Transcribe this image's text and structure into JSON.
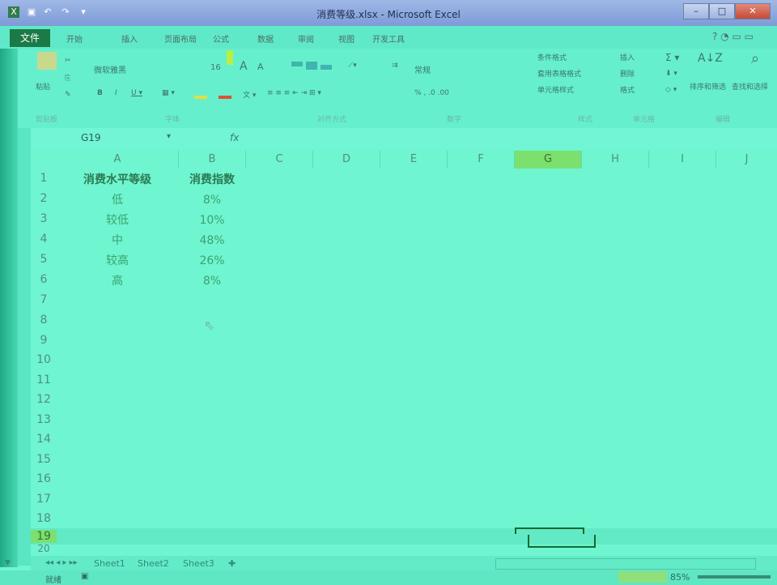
{
  "window": {
    "title": "消费等级.xlsx - Microsoft Excel",
    "quick_access": [
      "save-icon",
      "undo-icon",
      "redo-icon",
      "customize-icon"
    ],
    "buttons": [
      "minimize",
      "maximize",
      "close"
    ]
  },
  "ribbon": {
    "file_tab": "文件",
    "tabs": [
      "开始",
      "插入",
      "页面布局",
      "公式",
      "数据",
      "审阅",
      "视图",
      "开发工具"
    ],
    "font_name": "微软雅黑",
    "font_size": "16",
    "number_format": "常规",
    "paste_label": "粘贴",
    "styles": [
      "条件格式",
      "套用表格格式",
      "单元格样式"
    ],
    "cells": [
      "插入",
      "删除",
      "格式"
    ],
    "editing": [
      "排序和筛选",
      "查找和选择"
    ],
    "groups": [
      "剪贴板",
      "字体",
      "对齐方式",
      "数字",
      "样式",
      "单元格",
      "编辑"
    ]
  },
  "formula_bar": {
    "name_box": "G19",
    "fx": "fx",
    "value": ""
  },
  "sheet": {
    "columns": [
      "A",
      "B",
      "C",
      "D",
      "E",
      "F",
      "G",
      "H",
      "I",
      "J"
    ],
    "selected_column": "G",
    "rows": [
      "1",
      "2",
      "3",
      "4",
      "5",
      "6",
      "7",
      "8",
      "9",
      "10",
      "11",
      "12",
      "13",
      "14",
      "15",
      "16",
      "17",
      "18",
      "19",
      "20"
    ],
    "data": [
      [
        "消费水平等级",
        "消费指数"
      ],
      [
        "低",
        "8%"
      ],
      [
        "较低",
        "10%"
      ],
      [
        "中",
        "48%"
      ],
      [
        "较高",
        "26%"
      ],
      [
        "高",
        "8%"
      ]
    ]
  },
  "sheet_tabs": [
    "Sheet1",
    "Sheet2",
    "Sheet3"
  ],
  "status": {
    "ready": "就绪",
    "zoom": "85%"
  }
}
